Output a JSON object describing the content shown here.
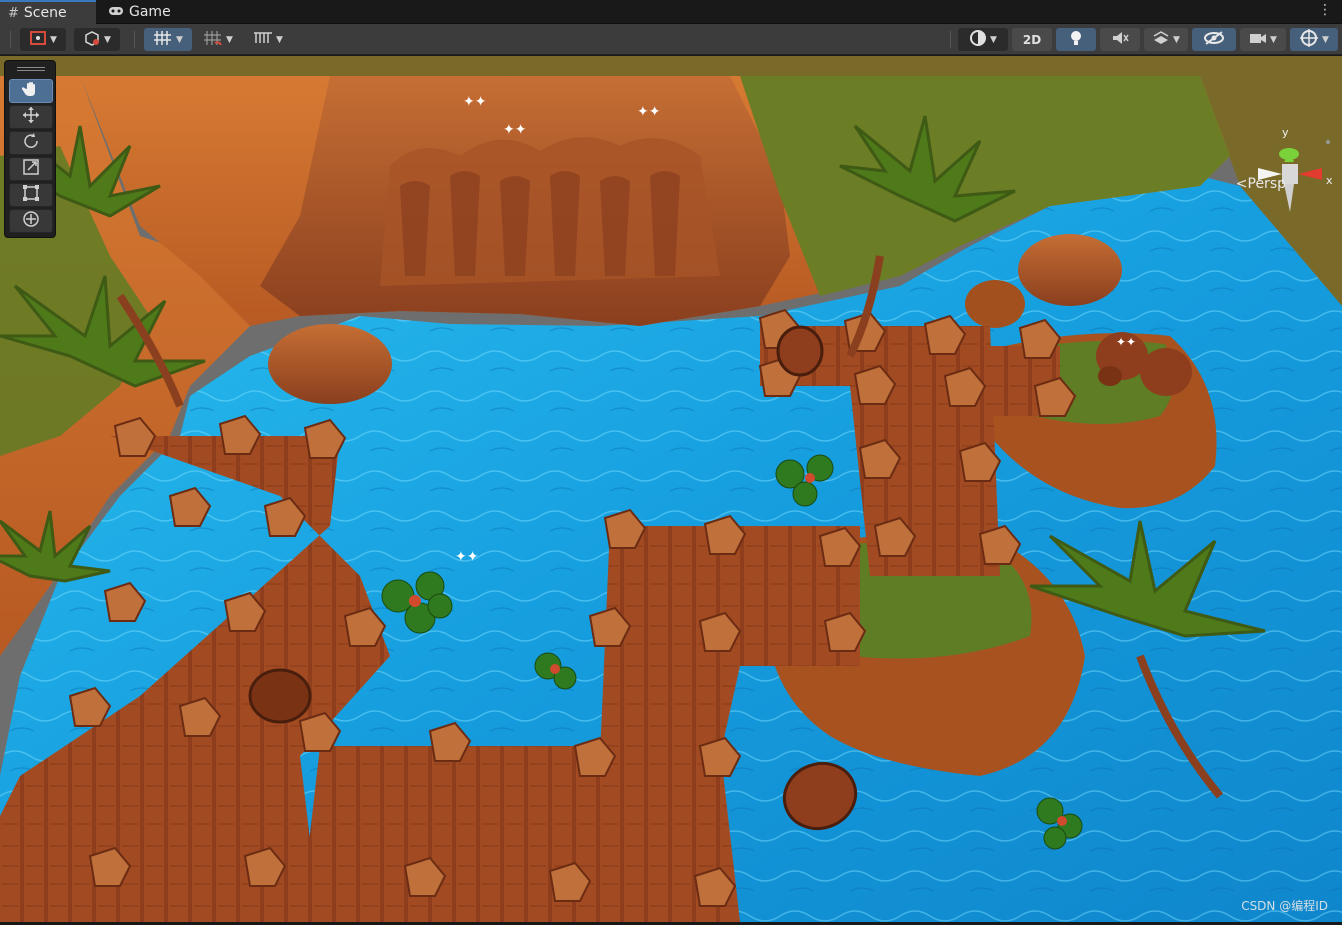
{
  "tabs": [
    {
      "label": "Scene",
      "icon": "grid-icon",
      "active": true
    },
    {
      "label": "Game",
      "icon": "gamepad-icon",
      "active": false
    }
  ],
  "toolbar": {
    "left": [
      "pivot-tool-icon",
      "global-tool-icon",
      "grid-snap-icon",
      "increment-snap-icon",
      "ruler-icon"
    ],
    "right": [
      "shading-mode-icon",
      "lighting-icon",
      "audio-icon",
      "effects-icon",
      "scene-visibility-icon",
      "camera-icon",
      "gizmos-icon"
    ],
    "mode_2d_label": "2D"
  },
  "tools": [
    {
      "name": "hand-tool",
      "active": true
    },
    {
      "name": "move-tool",
      "active": false
    },
    {
      "name": "rotate-tool",
      "active": false
    },
    {
      "name": "scale-tool",
      "active": false
    },
    {
      "name": "rect-tool",
      "active": false
    },
    {
      "name": "transform-tool",
      "active": false
    }
  ],
  "gizmo": {
    "y_label": "y",
    "x_label": "x",
    "projection_label": "Persp"
  },
  "watermark": "CSDN @编程ID",
  "colors": {
    "accent": "#3a79bb",
    "water": "#1aa8e8",
    "sand": "#c8702e",
    "wood": "#8a3f1e",
    "grass": "#5f7d24"
  }
}
